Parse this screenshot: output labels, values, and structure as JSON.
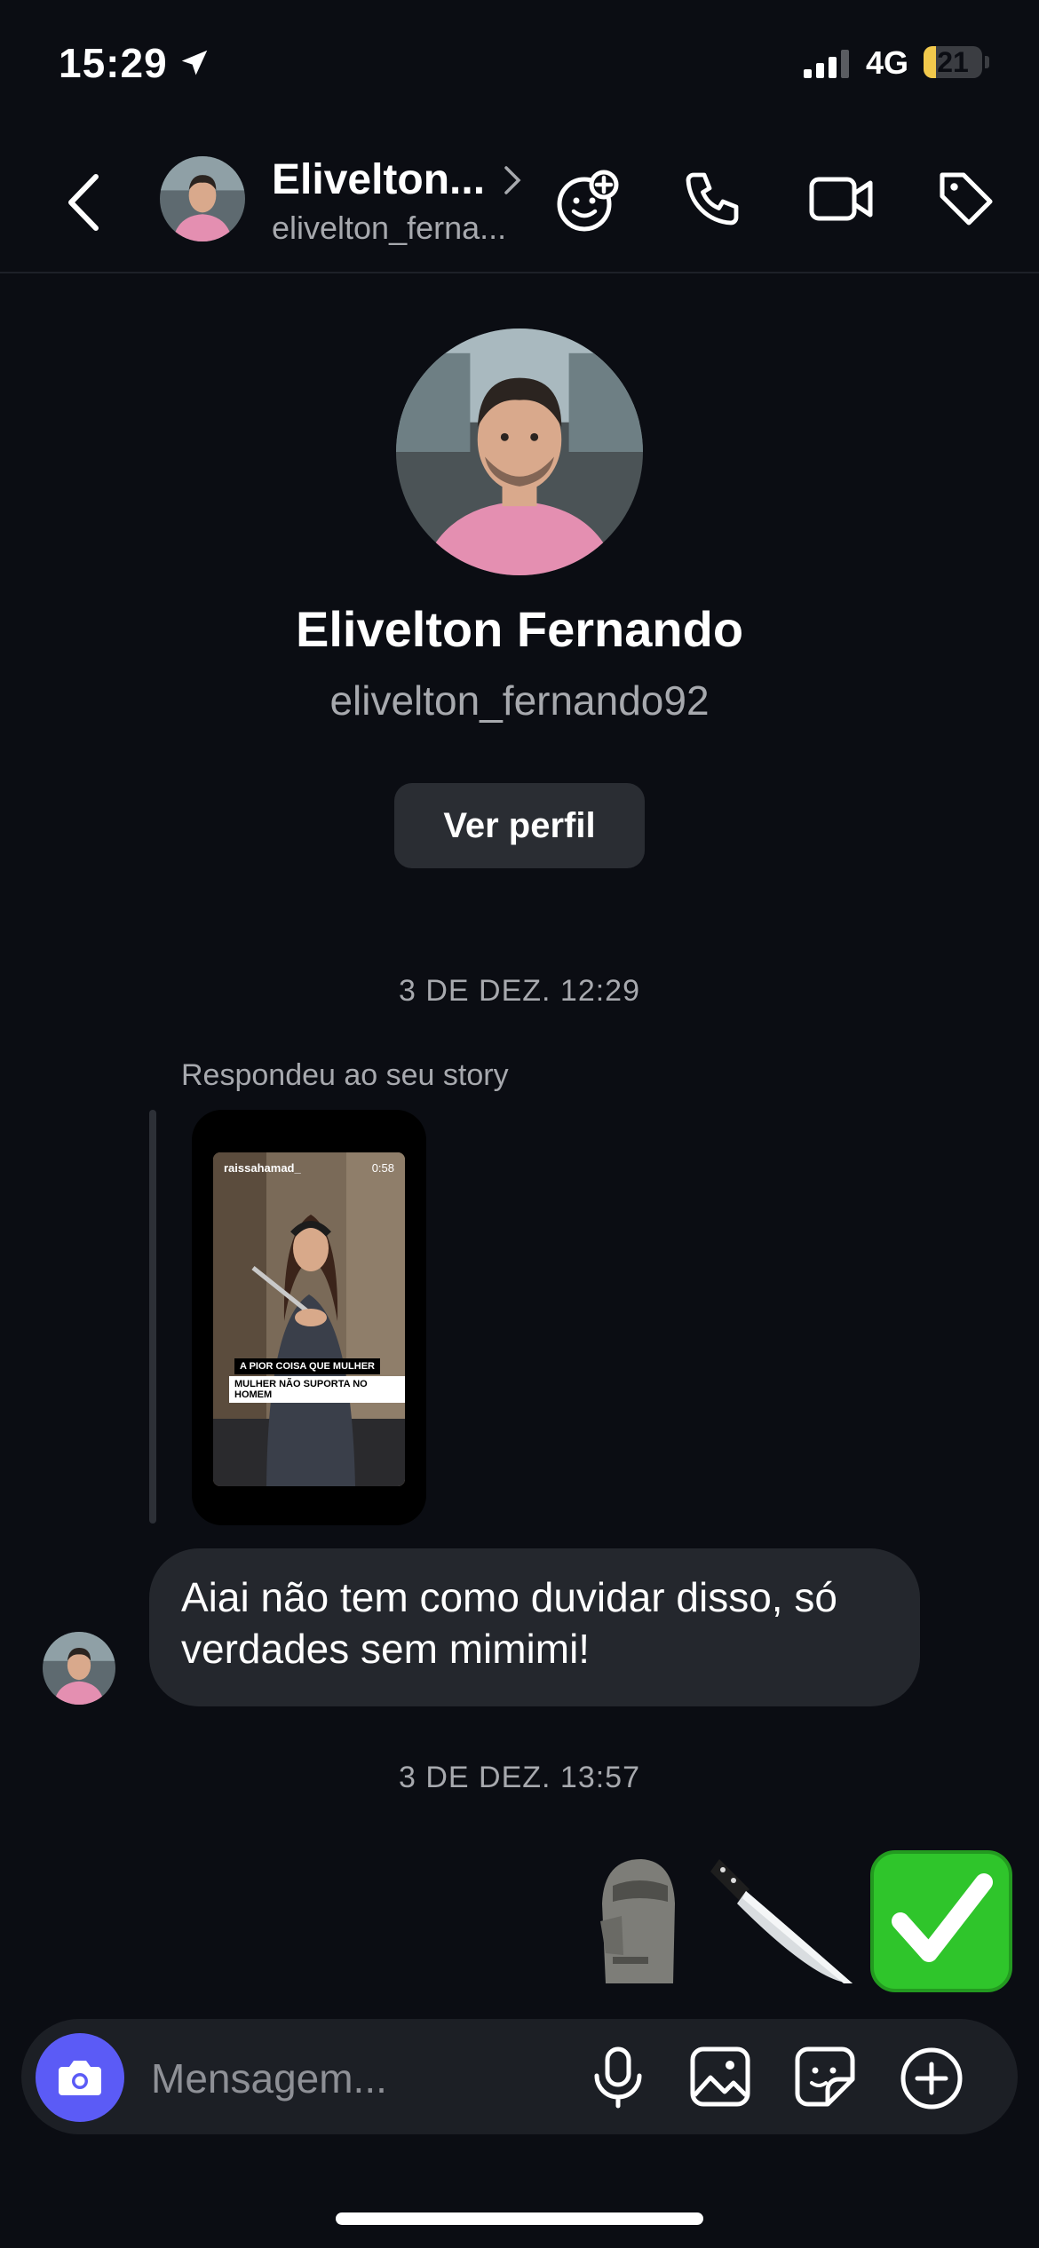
{
  "status_bar": {
    "time": "15:29",
    "network": "4G",
    "battery": "21",
    "battery_level": 0.21
  },
  "header": {
    "back_icon": "chevron-left-icon",
    "name": "Elivelton...",
    "handle": "elivelton_ferna...",
    "icons": [
      "add-emoji-icon",
      "phone-icon",
      "video-icon",
      "tag-icon"
    ]
  },
  "profile": {
    "name": "Elivelton Fernando",
    "handle": "elivelton_fernando92",
    "view_profile_label": "Ver perfil"
  },
  "conversation": {
    "timestamp_1": "3 DE DEZ. 12:29",
    "reply_label": "Respondeu ao seu story",
    "story": {
      "username": "raissahamad_",
      "duration": "0:58",
      "caption_line1": "A PIOR COISA QUE MULHER",
      "caption_line2": "MULHER NÃO SUPORTA NO HOMEM"
    },
    "incoming_message": "Aiai não tem como duvidar disso, só verdades sem mimimi!",
    "timestamp_2": "3 DE DEZ. 13:57",
    "outgoing_emojis": [
      "🗿",
      "🔪",
      "✅"
    ]
  },
  "composer": {
    "placeholder": "Mensagem...",
    "icons": [
      "camera-icon",
      "microphone-icon",
      "image-icon",
      "sticker-icon",
      "plus-icon"
    ],
    "camera_color": "#5b5bf6"
  }
}
